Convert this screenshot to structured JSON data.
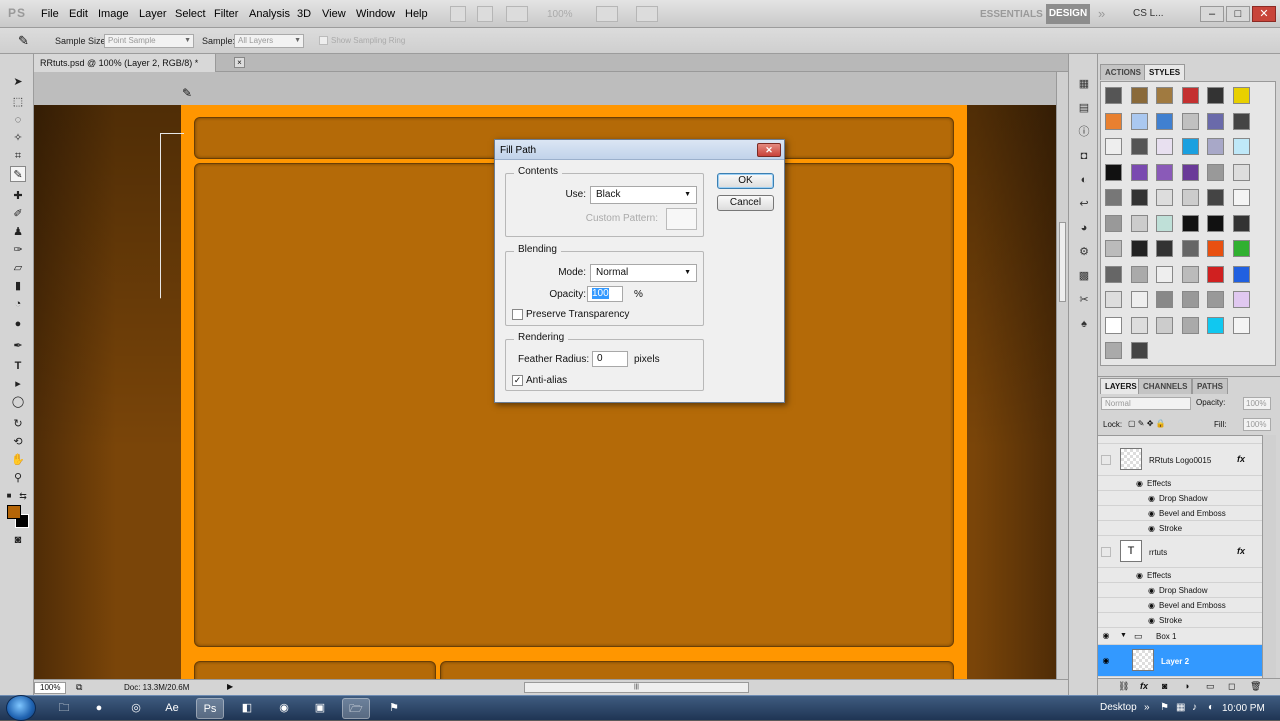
{
  "app": {
    "logo": "PS"
  },
  "menu": [
    "File",
    "Edit",
    "Image",
    "Layer",
    "Select",
    "Filter",
    "Analysis",
    "3D",
    "View",
    "Window",
    "Help"
  ],
  "menubar": {
    "zoom": "100%",
    "ws_essentials": "ESSENTIALS",
    "ws_design": "DESIGN",
    "ws_more": "»",
    "cs_live": "CS L...",
    "minimize": "–",
    "maximize": "□",
    "close": "✕"
  },
  "options": {
    "sample_size_label": "Sample Size:",
    "sample_size_value": "Point Sample",
    "sample_label": "Sample:",
    "sample_value": "All Layers",
    "ring_label": "Show Sampling Ring"
  },
  "document": {
    "tab_title": "RRtuts.psd @ 100% (Layer 2, RGB/8) *",
    "close": "×"
  },
  "status": {
    "zoom": "100%",
    "doc_info": "Doc: 13.3M/20.6M",
    "arrow": "▶",
    "grip": "|||"
  },
  "styles_panel": {
    "tab_actions": "ACTIONS",
    "tab_styles": "STYLES"
  },
  "layers_panel": {
    "tab_layers": "LAYERS",
    "tab_channels": "CHANNELS",
    "tab_paths": "PATHS",
    "blend_mode": "Normal",
    "opacity_label": "Opacity:",
    "opacity_value": "100%",
    "lock_label": "Lock:",
    "fill_label": "Fill:",
    "fill_value": "100%",
    "layers": [
      {
        "name": "RRtuts Logo0015",
        "fx": "fx"
      },
      {
        "name": "Effects"
      },
      {
        "name": "Drop Shadow"
      },
      {
        "name": "Bevel and Emboss"
      },
      {
        "name": "Stroke"
      },
      {
        "name": "rrtuts",
        "fx": "fx",
        "thumb": "T"
      },
      {
        "name": "Effects"
      },
      {
        "name": "Drop Shadow"
      },
      {
        "name": "Bevel and Emboss"
      },
      {
        "name": "Stroke"
      },
      {
        "name": "Box 1"
      },
      {
        "name": "Layer 2"
      }
    ]
  },
  "dialog": {
    "title": "Fill Path",
    "close": "✕",
    "contents_label": "Contents",
    "use_label": "Use:",
    "use_value": "Black",
    "custom_pattern_label": "Custom Pattern:",
    "blending_label": "Blending",
    "mode_label": "Mode:",
    "mode_value": "Normal",
    "opacity_label": "Opacity:",
    "opacity_value": "100",
    "opacity_unit": "%",
    "preserve_label": "Preserve Transparency",
    "rendering_label": "Rendering",
    "feather_label": "Feather Radius:",
    "feather_value": "0",
    "feather_unit": "pixels",
    "antialias_label": "Anti-alias",
    "ok": "OK",
    "cancel": "Cancel"
  },
  "taskbar": {
    "desktop": "Desktop",
    "clock": "10:00 PM"
  },
  "colors": {
    "foreground": "#b46508",
    "background": "#000000",
    "canvas_orange": "#ff9600",
    "box_fill": "#b46a08",
    "selected_layer": "#3399ff"
  }
}
